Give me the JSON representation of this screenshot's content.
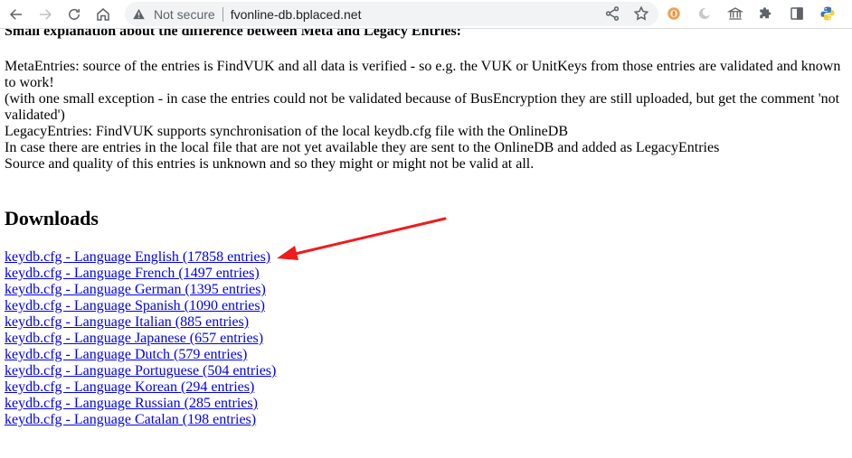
{
  "browser": {
    "security_label": "Not secure",
    "url": "fvonline-db.bplaced.net",
    "accent_arrow_color": "#ee1c1c"
  },
  "page": {
    "cut_heading": "Small explanation about the difference between Meta and Legacy Entries:",
    "paragraph_lines": [
      "MetaEntries: source of the entries is FindVUK and all data is verified - so e.g. the VUK or UnitKeys from those entries are validated and known to work!",
      "(with one small exception - in case the entries could not be validated because of BusEncryption they are still uploaded, but get the comment 'not validated')",
      "LegacyEntries: FindVUK supports synchronisation of the local keydb.cfg file with the OnlineDB",
      "In case there are entries in the local file that are not yet available they are sent to the OnlineDB and added as LegacyEntries",
      "Source and quality of this entries is unknown and so they might or might not be valid at all."
    ],
    "downloads_title": "Downloads",
    "downloads": [
      "keydb.cfg - Language English (17858 entries)",
      "keydb.cfg - Language French (1497 entries)",
      "keydb.cfg - Language German (1395 entries)",
      "keydb.cfg - Language Spanish (1090 entries)",
      "keydb.cfg - Language Italian (885 entries)",
      "keydb.cfg - Language Japanese (657 entries)",
      "keydb.cfg - Language Dutch (579 entries)",
      "keydb.cfg - Language Portuguese (504 entries)",
      "keydb.cfg - Language Korean (294 entries)",
      "keydb.cfg - Language Russian (285 entries)",
      "keydb.cfg - Language Catalan (198 entries)"
    ]
  }
}
